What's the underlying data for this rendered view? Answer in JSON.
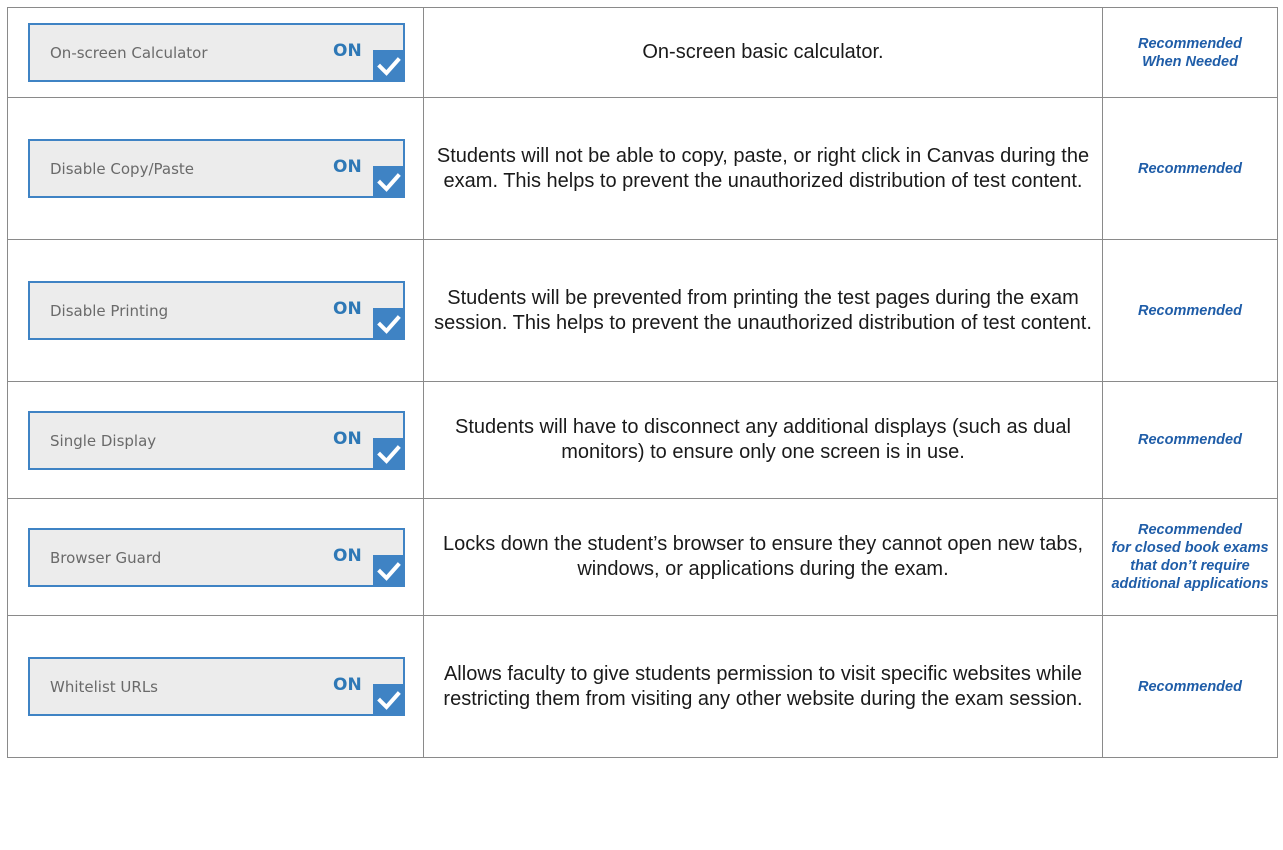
{
  "accent_color": "#3f83c4",
  "rows": [
    {
      "setting": "On-screen Calculator",
      "state": "ON",
      "checked": true,
      "description": "On-screen basic calculator.",
      "recommendation": "Recommended\nWhen Needed"
    },
    {
      "setting": "Disable Copy/Paste",
      "state": "ON",
      "checked": true,
      "description": "Students will not be able to copy, paste, or right click in Canvas during the exam. This helps to prevent the unauthorized distribution of test content.",
      "recommendation": "Recommended"
    },
    {
      "setting": "Disable Printing",
      "state": "ON",
      "checked": true,
      "description": "Students will be prevented from printing the test pages during the exam session. This helps to prevent the unauthorized distribution of test content.",
      "recommendation": "Recommended"
    },
    {
      "setting": "Single Display",
      "state": "ON",
      "checked": true,
      "description": "Students will have to disconnect any additional displays (such as dual monitors) to ensure only one screen is in use.",
      "recommendation": "Recommended"
    },
    {
      "setting": "Browser Guard",
      "state": "ON",
      "checked": true,
      "description": "Locks down the student’s browser to ensure they cannot open new tabs, windows, or applications during the exam.",
      "recommendation": "Recommended\nfor closed book exams\nthat don’t require\nadditional applications"
    },
    {
      "setting": "Whitelist URLs",
      "state": "ON",
      "checked": true,
      "description": "Allows faculty to give students permission to visit specific websites while restricting them from visiting any other website during the exam session.",
      "recommendation": "Recommended"
    }
  ]
}
